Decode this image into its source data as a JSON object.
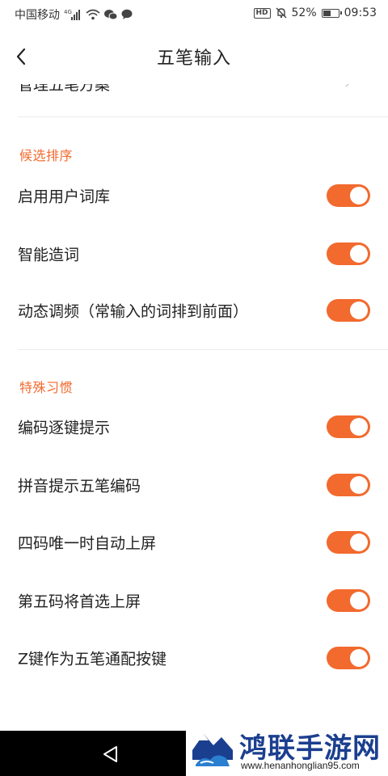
{
  "status_bar": {
    "carrier": "中国移动",
    "network": "4G",
    "hd": "HD",
    "battery": "52%",
    "battery_level": 0.52,
    "time": "09:53"
  },
  "title_bar": {
    "title": "五笔输入"
  },
  "cut_row": {
    "label": "管理五笔方案"
  },
  "sections": [
    {
      "header": "候选排序",
      "items": [
        {
          "label": "启用用户词库",
          "on": true
        },
        {
          "label": "智能造词",
          "on": true
        },
        {
          "label": "动态调频（常输入的词排到前面）",
          "on": true
        }
      ]
    },
    {
      "header": "特殊习惯",
      "items": [
        {
          "label": "编码逐键提示",
          "on": true
        },
        {
          "label": "拼音提示五笔编码",
          "on": true
        },
        {
          "label": "四码唯一时自动上屏",
          "on": true
        },
        {
          "label": "第五码将首选上屏",
          "on": true
        },
        {
          "label": "Z键作为五笔通配按键",
          "on": true
        }
      ]
    }
  ],
  "colors": {
    "accent": "#f26a2e",
    "watermark_blue": "#1b3f8f"
  },
  "watermark": {
    "name": "鸿联手游网",
    "url": "www.henanhonglian95.com"
  }
}
